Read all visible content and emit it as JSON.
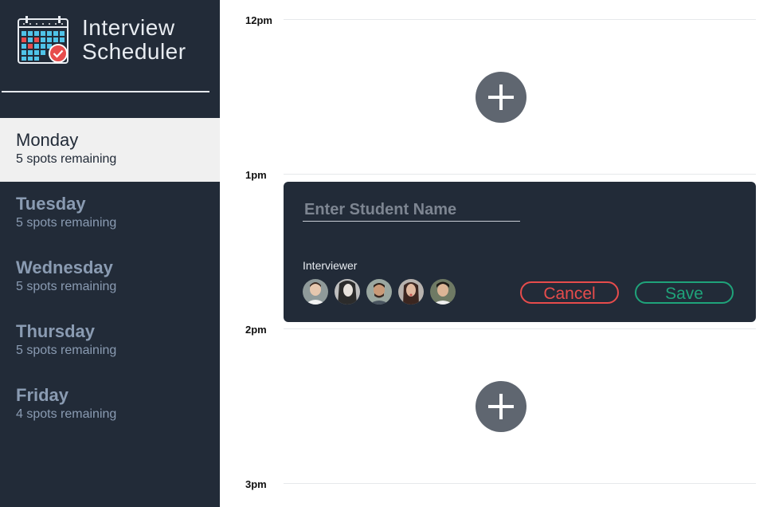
{
  "app": {
    "title_line1": "Interview",
    "title_line2": "Scheduler",
    "logo_icon": "calendar-check-icon"
  },
  "days": [
    {
      "name": "Monday",
      "spots": "5 spots remaining",
      "selected": true
    },
    {
      "name": "Tuesday",
      "spots": "5 spots remaining",
      "selected": false
    },
    {
      "name": "Wednesday",
      "spots": "5 spots remaining",
      "selected": false
    },
    {
      "name": "Thursday",
      "spots": "5 spots remaining",
      "selected": false
    },
    {
      "name": "Friday",
      "spots": "4 spots remaining",
      "selected": false
    }
  ],
  "schedule": {
    "times": [
      "12pm",
      "1pm",
      "2pm",
      "3pm"
    ],
    "add_icon": "plus-icon"
  },
  "form": {
    "placeholder": "Enter Student Name",
    "value": "",
    "interviewer_label": "Interviewer",
    "cancel_label": "Cancel",
    "save_label": "Save",
    "avatar_count": 5
  },
  "colors": {
    "sidebar_bg": "#222b38",
    "selected_bg": "#f0f0f0",
    "muted_text": "#8a9bb2",
    "cancel": "#e74c4c",
    "save": "#1fa37a",
    "add_button": "#5f6670"
  }
}
